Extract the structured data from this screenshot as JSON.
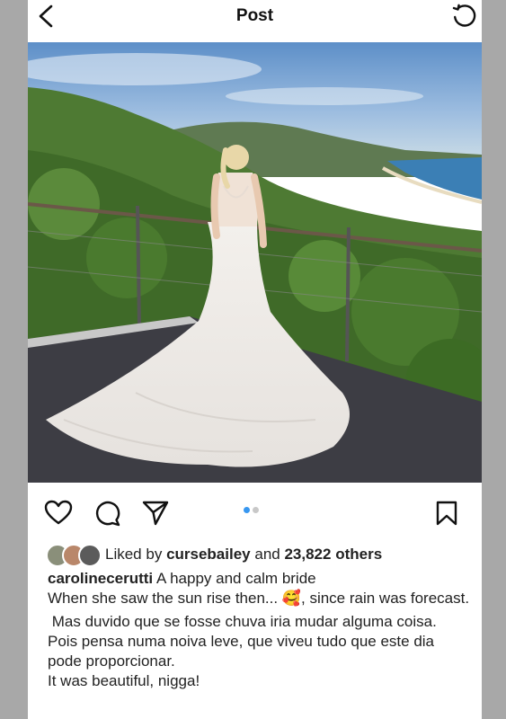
{
  "header": {
    "title": "Post",
    "back_icon": "chevron-left-icon",
    "right_icon": "refresh-icon"
  },
  "photo": {
    "description_icon": "photo"
  },
  "actions": {
    "icons": [
      "heart-icon",
      "comment-icon",
      "share-icon",
      "bookmark-icon"
    ],
    "carousel": {
      "count": 2,
      "active": 0,
      "active_color": "#3897f0",
      "inactive_color": "#c8c8c8"
    }
  },
  "likes": {
    "prefix": "Liked by",
    "user": "cursebailey",
    "middle": "and",
    "count": "23,822 others"
  },
  "caption": {
    "username": "carolinecerutti",
    "headline": "A happy and calm bride",
    "line1": "When she saw the sun rise then...",
    "emoji": "🥰",
    "line1_end": ", since rain was forecast.",
    "para2": " Mas duvido que se fosse chuva iria mudar alguma coisa. Pois pensa numa noiva leve, que viveu tudo que este dia pode proporcionar.",
    "para3": "It was beautiful, nigga!"
  },
  "colors": {
    "background": "#a8a8a8",
    "card": "#ffffff",
    "text": "#222222"
  }
}
